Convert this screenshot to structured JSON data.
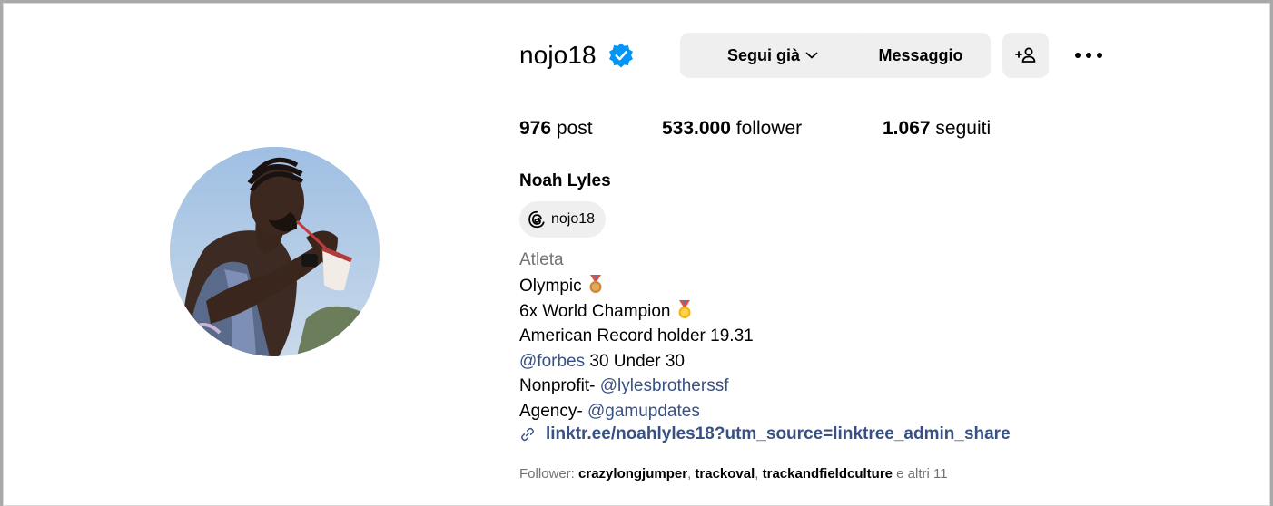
{
  "profile": {
    "username": "nojo18",
    "verified": true,
    "full_name": "Noah Lyles",
    "threads_handle": "nojo18",
    "category": "Atleta"
  },
  "actions": {
    "follow_label": "Segui già",
    "message_label": "Messaggio",
    "add_user_label": "+⾏"
  },
  "stats": {
    "posts_count": "976",
    "posts_label": "post",
    "followers_count": "533.000",
    "followers_label": "follower",
    "following_count": "1.067",
    "following_label": "seguiti"
  },
  "bio": {
    "line1": "Olympic",
    "line2": "6x World Champion",
    "line3": "American Record holder 19.31",
    "line4_mention": "@forbes",
    "line4_text": " 30 Under 30",
    "line5_text": "Nonprofit- ",
    "line5_mention": "@lylesbrotherssf",
    "line6_text": "Agency- ",
    "line6_mention": "@gamupdates",
    "link": "linktr.ee/noahlyles18?utm_source=linktree_admin_share"
  },
  "followed_by": {
    "prefix": "Follower: ",
    "user1": "crazylongjumper",
    "sep1": ", ",
    "user2": "trackoval",
    "sep2": ", ",
    "user3": "trackandfieldculture",
    "suffix": " e altri 11"
  },
  "colors": {
    "verified_blue": "#0095f6",
    "link_blue": "#385185",
    "button_bg": "#efefef",
    "secondary_text": "#737373"
  },
  "icons": [
    "verified-badge-icon",
    "chevron-down-icon",
    "add-user-icon",
    "more-options-icon",
    "threads-icon",
    "medal-icon",
    "link-icon"
  ]
}
